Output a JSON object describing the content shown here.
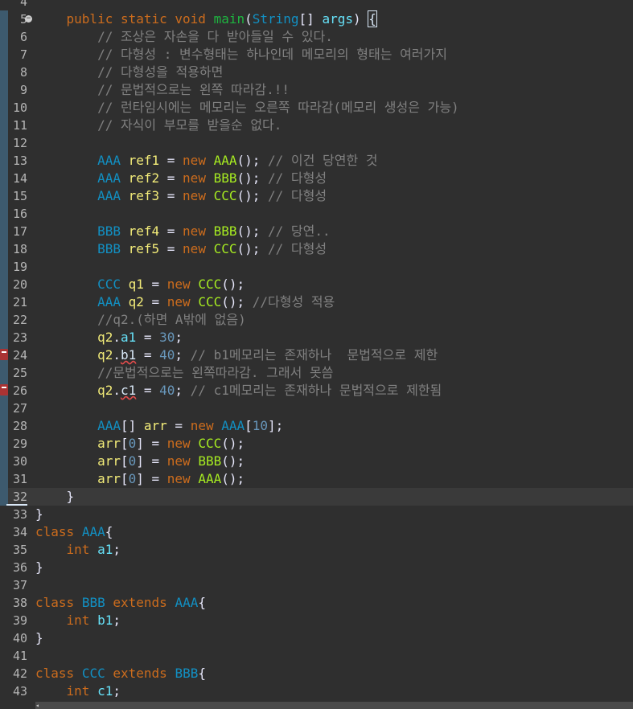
{
  "editor": {
    "lines": [
      {
        "n": "4",
        "t": []
      },
      {
        "n": "5",
        "t": [
          [
            "",
            ""
          ]
        ],
        "fold": true,
        "changed": true
      },
      {
        "n": "6",
        "changed": true
      },
      {
        "n": "7",
        "changed": true
      },
      {
        "n": "8",
        "changed": true
      },
      {
        "n": "9",
        "changed": true
      },
      {
        "n": "10",
        "changed": true
      },
      {
        "n": "11",
        "changed": true
      },
      {
        "n": "12",
        "changed": true
      },
      {
        "n": "13",
        "changed": true
      },
      {
        "n": "14",
        "changed": true
      },
      {
        "n": "15",
        "changed": true
      },
      {
        "n": "16",
        "changed": true
      },
      {
        "n": "17",
        "changed": true
      },
      {
        "n": "18",
        "changed": true
      },
      {
        "n": "19",
        "changed": true
      },
      {
        "n": "20",
        "changed": true
      },
      {
        "n": "21",
        "changed": true
      },
      {
        "n": "22",
        "changed": true
      },
      {
        "n": "23",
        "changed": true
      },
      {
        "n": "24",
        "changed": true,
        "error": true
      },
      {
        "n": "25",
        "changed": true
      },
      {
        "n": "26",
        "changed": true,
        "error": true
      },
      {
        "n": "27",
        "changed": true
      },
      {
        "n": "28",
        "changed": true
      },
      {
        "n": "29",
        "changed": true
      },
      {
        "n": "30",
        "changed": true
      },
      {
        "n": "31",
        "changed": true
      },
      {
        "n": "32",
        "changed": true,
        "current": true
      },
      {
        "n": "33"
      },
      {
        "n": "34"
      },
      {
        "n": "35"
      },
      {
        "n": "36"
      },
      {
        "n": "37"
      },
      {
        "n": "38"
      },
      {
        "n": "39"
      },
      {
        "n": "40"
      },
      {
        "n": "41"
      },
      {
        "n": "42"
      },
      {
        "n": "43"
      }
    ],
    "code": [
      [],
      [
        [
          "    ",
          ""
        ],
        [
          "public",
          "kw"
        ],
        [
          " ",
          ""
        ],
        [
          "static",
          "kw"
        ],
        [
          " ",
          ""
        ],
        [
          "void",
          "kw"
        ],
        [
          " ",
          ""
        ],
        [
          "main",
          "fn"
        ],
        [
          "(",
          "op"
        ],
        [
          "String",
          "ty"
        ],
        [
          "[] ",
          "op"
        ],
        [
          "args",
          "fld"
        ],
        [
          ") ",
          "op"
        ],
        [
          "{",
          "bracket"
        ]
      ],
      [
        [
          "        ",
          ""
        ],
        [
          "// 조상은 자손을 다 받아들일 수 있다.",
          "cm"
        ]
      ],
      [
        [
          "        ",
          ""
        ],
        [
          "// 다형성 : 변수형태는 하나인데 메모리의 형태는 여러가지",
          "cm"
        ]
      ],
      [
        [
          "        ",
          ""
        ],
        [
          "// 다형성을 적용하면",
          "cm"
        ]
      ],
      [
        [
          "        ",
          ""
        ],
        [
          "// 문법적으로는 왼쪽 따라감.!!",
          "cm"
        ]
      ],
      [
        [
          "        ",
          ""
        ],
        [
          "// 런타임시에는 메모리는 오른쪽 따라감(메모리 생성은 가능)",
          "cm"
        ]
      ],
      [
        [
          "        ",
          ""
        ],
        [
          "// 자식이 부모를 받을순 없다.",
          "cm"
        ]
      ],
      [],
      [
        [
          "        ",
          ""
        ],
        [
          "AAA",
          "ty"
        ],
        [
          " ",
          ""
        ],
        [
          "ref1",
          "var"
        ],
        [
          " = ",
          "op"
        ],
        [
          "new",
          "kw"
        ],
        [
          " ",
          ""
        ],
        [
          "AAA",
          "cls"
        ],
        [
          "(); ",
          "op"
        ],
        [
          "// 이건 당연한 것",
          "cm"
        ]
      ],
      [
        [
          "        ",
          ""
        ],
        [
          "AAA",
          "ty"
        ],
        [
          " ",
          ""
        ],
        [
          "ref2",
          "var"
        ],
        [
          " = ",
          "op"
        ],
        [
          "new",
          "kw"
        ],
        [
          " ",
          ""
        ],
        [
          "BBB",
          "cls"
        ],
        [
          "(); ",
          "op"
        ],
        [
          "// 다형성",
          "cm"
        ]
      ],
      [
        [
          "        ",
          ""
        ],
        [
          "AAA",
          "ty"
        ],
        [
          " ",
          ""
        ],
        [
          "ref3",
          "var"
        ],
        [
          " = ",
          "op"
        ],
        [
          "new",
          "kw"
        ],
        [
          " ",
          ""
        ],
        [
          "CCC",
          "cls"
        ],
        [
          "(); ",
          "op"
        ],
        [
          "// 다형성",
          "cm"
        ]
      ],
      [],
      [
        [
          "        ",
          ""
        ],
        [
          "BBB",
          "ty"
        ],
        [
          " ",
          ""
        ],
        [
          "ref4",
          "var"
        ],
        [
          " = ",
          "op"
        ],
        [
          "new",
          "kw"
        ],
        [
          " ",
          ""
        ],
        [
          "BBB",
          "cls"
        ],
        [
          "(); ",
          "op"
        ],
        [
          "// 당연..",
          "cm"
        ]
      ],
      [
        [
          "        ",
          ""
        ],
        [
          "BBB",
          "ty"
        ],
        [
          " ",
          ""
        ],
        [
          "ref5",
          "var"
        ],
        [
          " = ",
          "op"
        ],
        [
          "new",
          "kw"
        ],
        [
          " ",
          ""
        ],
        [
          "CCC",
          "cls"
        ],
        [
          "(); ",
          "op"
        ],
        [
          "// 다형성",
          "cm"
        ]
      ],
      [],
      [
        [
          "        ",
          ""
        ],
        [
          "CCC",
          "ty"
        ],
        [
          " ",
          ""
        ],
        [
          "q1",
          "var"
        ],
        [
          " = ",
          "op"
        ],
        [
          "new",
          "kw"
        ],
        [
          " ",
          ""
        ],
        [
          "CCC",
          "cls"
        ],
        [
          "();",
          "op"
        ]
      ],
      [
        [
          "        ",
          ""
        ],
        [
          "AAA",
          "ty"
        ],
        [
          " ",
          ""
        ],
        [
          "q2",
          "var"
        ],
        [
          " = ",
          "op"
        ],
        [
          "new",
          "kw"
        ],
        [
          " ",
          ""
        ],
        [
          "CCC",
          "cls"
        ],
        [
          "(); ",
          "op"
        ],
        [
          "//다형성 적용",
          "cm"
        ]
      ],
      [
        [
          "        ",
          ""
        ],
        [
          "//q2.(하면 A밖에 없음)",
          "cm"
        ]
      ],
      [
        [
          "        ",
          ""
        ],
        [
          "q2",
          "var"
        ],
        [
          ".",
          "op"
        ],
        [
          "a1",
          "fld"
        ],
        [
          " = ",
          "op"
        ],
        [
          "30",
          "num"
        ],
        [
          ";",
          "op"
        ]
      ],
      [
        [
          "        ",
          ""
        ],
        [
          "q2",
          "var"
        ],
        [
          ".",
          "op"
        ],
        [
          "b1",
          "squig"
        ],
        [
          " = ",
          "op"
        ],
        [
          "40",
          "num"
        ],
        [
          "; ",
          "op"
        ],
        [
          "// b1메모리는 존재하나  문법적으로 제한",
          "cm"
        ]
      ],
      [
        [
          "        ",
          ""
        ],
        [
          "//문법적으로는 왼쪽따라감. 그래서 못씀",
          "cm"
        ]
      ],
      [
        [
          "        ",
          ""
        ],
        [
          "q2",
          "var"
        ],
        [
          ".",
          "op"
        ],
        [
          "c1",
          "squig"
        ],
        [
          " = ",
          "op"
        ],
        [
          "40",
          "num"
        ],
        [
          "; ",
          "op"
        ],
        [
          "// c1메모리는 존재하나 문법적으로 제한됨",
          "cm"
        ]
      ],
      [],
      [
        [
          "        ",
          ""
        ],
        [
          "AAA",
          "ty"
        ],
        [
          "[] ",
          "op"
        ],
        [
          "arr",
          "var"
        ],
        [
          " = ",
          "op"
        ],
        [
          "new",
          "kw"
        ],
        [
          " ",
          ""
        ],
        [
          "AAA",
          "ty"
        ],
        [
          "[",
          "op"
        ],
        [
          "10",
          "num"
        ],
        [
          "];",
          "op"
        ]
      ],
      [
        [
          "        ",
          ""
        ],
        [
          "arr",
          "var"
        ],
        [
          "[",
          "op"
        ],
        [
          "0",
          "num"
        ],
        [
          "] = ",
          "op"
        ],
        [
          "new",
          "kw"
        ],
        [
          " ",
          ""
        ],
        [
          "CCC",
          "cls"
        ],
        [
          "();",
          "op"
        ]
      ],
      [
        [
          "        ",
          ""
        ],
        [
          "arr",
          "var"
        ],
        [
          "[",
          "op"
        ],
        [
          "0",
          "num"
        ],
        [
          "] = ",
          "op"
        ],
        [
          "new",
          "kw"
        ],
        [
          " ",
          ""
        ],
        [
          "BBB",
          "cls"
        ],
        [
          "();",
          "op"
        ]
      ],
      [
        [
          "        ",
          ""
        ],
        [
          "arr",
          "var"
        ],
        [
          "[",
          "op"
        ],
        [
          "0",
          "num"
        ],
        [
          "] = ",
          "op"
        ],
        [
          "new",
          "kw"
        ],
        [
          " ",
          ""
        ],
        [
          "AAA",
          "cls"
        ],
        [
          "();",
          "op"
        ]
      ],
      [
        [
          "    ",
          ""
        ],
        [
          "}",
          "op"
        ]
      ],
      [
        [
          "}",
          "op"
        ]
      ],
      [
        [
          "class",
          "kw"
        ],
        [
          " ",
          ""
        ],
        [
          "AAA",
          "ty"
        ],
        [
          "{",
          "op"
        ]
      ],
      [
        [
          "    ",
          ""
        ],
        [
          "int",
          "kw"
        ],
        [
          " ",
          ""
        ],
        [
          "a1",
          "fld"
        ],
        [
          ";",
          "op"
        ]
      ],
      [
        [
          "}",
          "op"
        ]
      ],
      [],
      [
        [
          "class",
          "kw"
        ],
        [
          " ",
          ""
        ],
        [
          "BBB",
          "ty"
        ],
        [
          " ",
          ""
        ],
        [
          "extends",
          "kw"
        ],
        [
          " ",
          ""
        ],
        [
          "AAA",
          "ty"
        ],
        [
          "{",
          "op"
        ]
      ],
      [
        [
          "    ",
          ""
        ],
        [
          "int",
          "kw"
        ],
        [
          " ",
          ""
        ],
        [
          "b1",
          "fld"
        ],
        [
          ";",
          "op"
        ]
      ],
      [
        [
          "}",
          "op"
        ]
      ],
      [],
      [
        [
          "class",
          "kw"
        ],
        [
          " ",
          ""
        ],
        [
          "CCC",
          "ty"
        ],
        [
          " ",
          ""
        ],
        [
          "extends",
          "kw"
        ],
        [
          " ",
          ""
        ],
        [
          "BBB",
          "ty"
        ],
        [
          "{",
          "op"
        ]
      ],
      [
        [
          "    ",
          ""
        ],
        [
          "int",
          "kw"
        ],
        [
          " ",
          ""
        ],
        [
          "c1",
          "fld"
        ],
        [
          ";",
          "op"
        ]
      ]
    ]
  },
  "scrollbar": {
    "left_arrow": "◂"
  }
}
